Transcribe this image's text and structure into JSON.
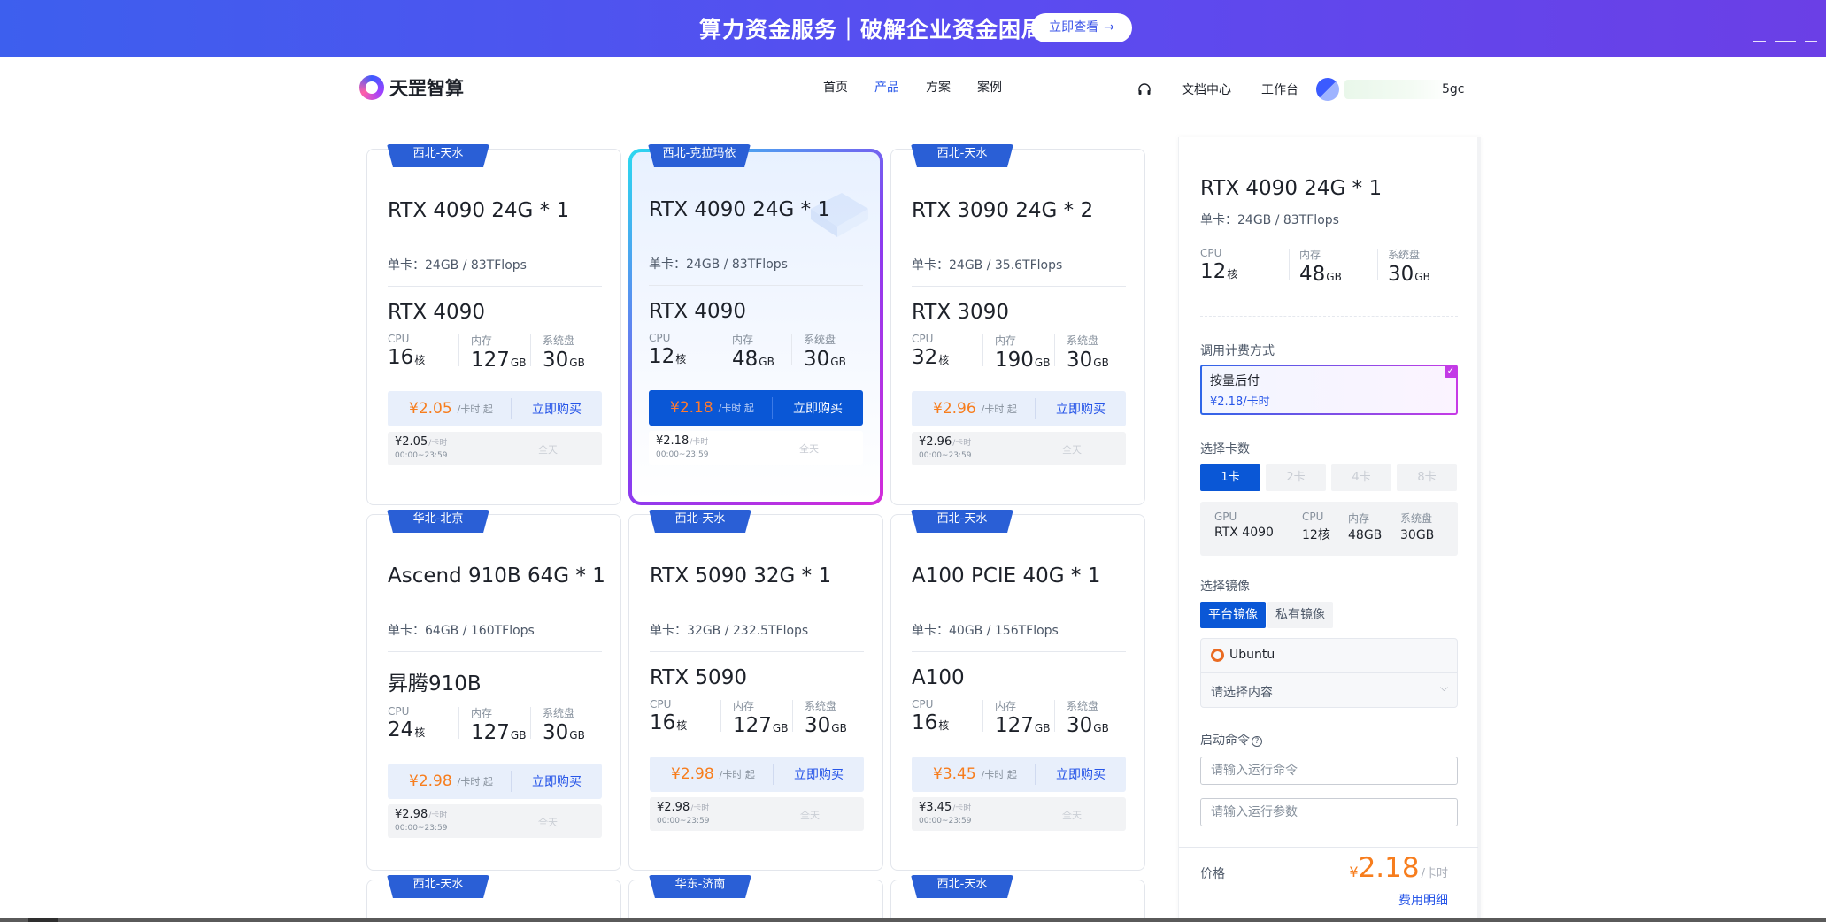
{
  "banner": {
    "title": "算力资金服务｜破解企业资金困局",
    "button_label": "立即查看",
    "button_arrow": "→"
  },
  "nav": {
    "logo_text": "天罡智算",
    "links": [
      "首页",
      "产品",
      "方案",
      "案例"
    ],
    "active_link": "产品",
    "docs_label": "文档中心",
    "workspace_label": "工作台",
    "user_suffix": "5gc"
  },
  "cards": [
    {
      "region": "西北-天水",
      "title": "RTX 4090 24G * 1",
      "single": "单卡：24GB / 83TFlops",
      "model": "RTX 4090",
      "cpu": "16",
      "mem": "127",
      "disk": "30",
      "price": "¥2.05",
      "time_price": "¥2.05"
    },
    {
      "region": "西北-克拉玛依",
      "title": "RTX 4090 24G * 1",
      "single": "单卡：24GB / 83TFlops",
      "model": "RTX 4090",
      "cpu": "12",
      "mem": "48",
      "disk": "30",
      "price": "¥2.18",
      "time_price": "¥2.18",
      "selected": true
    },
    {
      "region": "西北-天水",
      "title": "RTX 3090 24G * 2",
      "single": "单卡：24GB / 35.6TFlops",
      "model": "RTX 3090",
      "cpu": "32",
      "mem": "190",
      "disk": "30",
      "price": "¥2.96",
      "time_price": "¥2.96"
    },
    {
      "region": "华北-北京",
      "title": "Ascend 910B 64G * 1",
      "single": "单卡：64GB / 160TFlops",
      "model": "昇腾910B",
      "cpu": "24",
      "mem": "127",
      "disk": "30",
      "price": "¥2.98",
      "time_price": "¥2.98"
    },
    {
      "region": "西北-天水",
      "title": "RTX 5090 32G * 1",
      "single": "单卡：32GB / 232.5TFlops",
      "model": "RTX 5090",
      "cpu": "16",
      "mem": "127",
      "disk": "30",
      "price": "¥2.98",
      "time_price": "¥2.98"
    },
    {
      "region": "西北-天水",
      "title": "A100 PCIE 40G * 1",
      "single": "单卡：40GB / 156TFlops",
      "model": "A100",
      "cpu": "16",
      "mem": "127",
      "disk": "30",
      "price": "¥3.45",
      "time_price": "¥3.45"
    }
  ],
  "partial_cards": [
    {
      "region": "西北-天水"
    },
    {
      "region": "华东-济南"
    },
    {
      "region": "西北-天水"
    }
  ],
  "card_labels": {
    "cpu": "CPU",
    "mem": "内存",
    "disk": "系统盘",
    "cpu_unit": "核",
    "gb_unit": "GB",
    "price_suffix": "/卡时 起",
    "buy": "立即购买",
    "time_unit": "/卡时",
    "time_range": "00:00~23:59",
    "all_day": "全天"
  },
  "panel": {
    "title": "RTX 4090 24G * 1",
    "single": "单卡：24GB / 83TFlops",
    "cpu_label": "CPU",
    "cpu_value": "12",
    "cpu_unit": "核",
    "mem_label": "内存",
    "mem_value": "48",
    "mem_unit": "GB",
    "disk_label": "系统盘",
    "disk_value": "30",
    "disk_unit": "GB",
    "billing_label": "调用计费方式",
    "billing_name": "按量后付",
    "billing_price": "¥2.18/卡时",
    "count_label": "选择卡数",
    "counts": [
      "1卡",
      "2卡",
      "4卡",
      "8卡"
    ],
    "selected_count": "1卡",
    "config": {
      "gpu_label": "GPU",
      "gpu_value": "RTX 4090",
      "cpu_label": "CPU",
      "cpu_value": "12核",
      "mem_label": "内存",
      "mem_value": "48GB",
      "disk_label": "系统盘",
      "disk_value": "30GB"
    },
    "image_label": "选择镜像",
    "image_tabs": [
      "平台镜像",
      "私有镜像"
    ],
    "image_os": "Ubuntu",
    "image_placeholder": "请选择内容",
    "command_label": "启动命令",
    "command_help": "?",
    "command_placeholder": "请输入运行命令",
    "args_placeholder": "请输入运行参数",
    "price_label": "价格",
    "total_currency": "¥",
    "total_value": "2.18",
    "total_unit": "/卡时",
    "fee_detail": "费用明细"
  },
  "colors": {
    "brand": "#0a57d6",
    "price": "#f77d1d",
    "banner_start": "#3d5fee",
    "banner_end": "#6b3fe6"
  }
}
